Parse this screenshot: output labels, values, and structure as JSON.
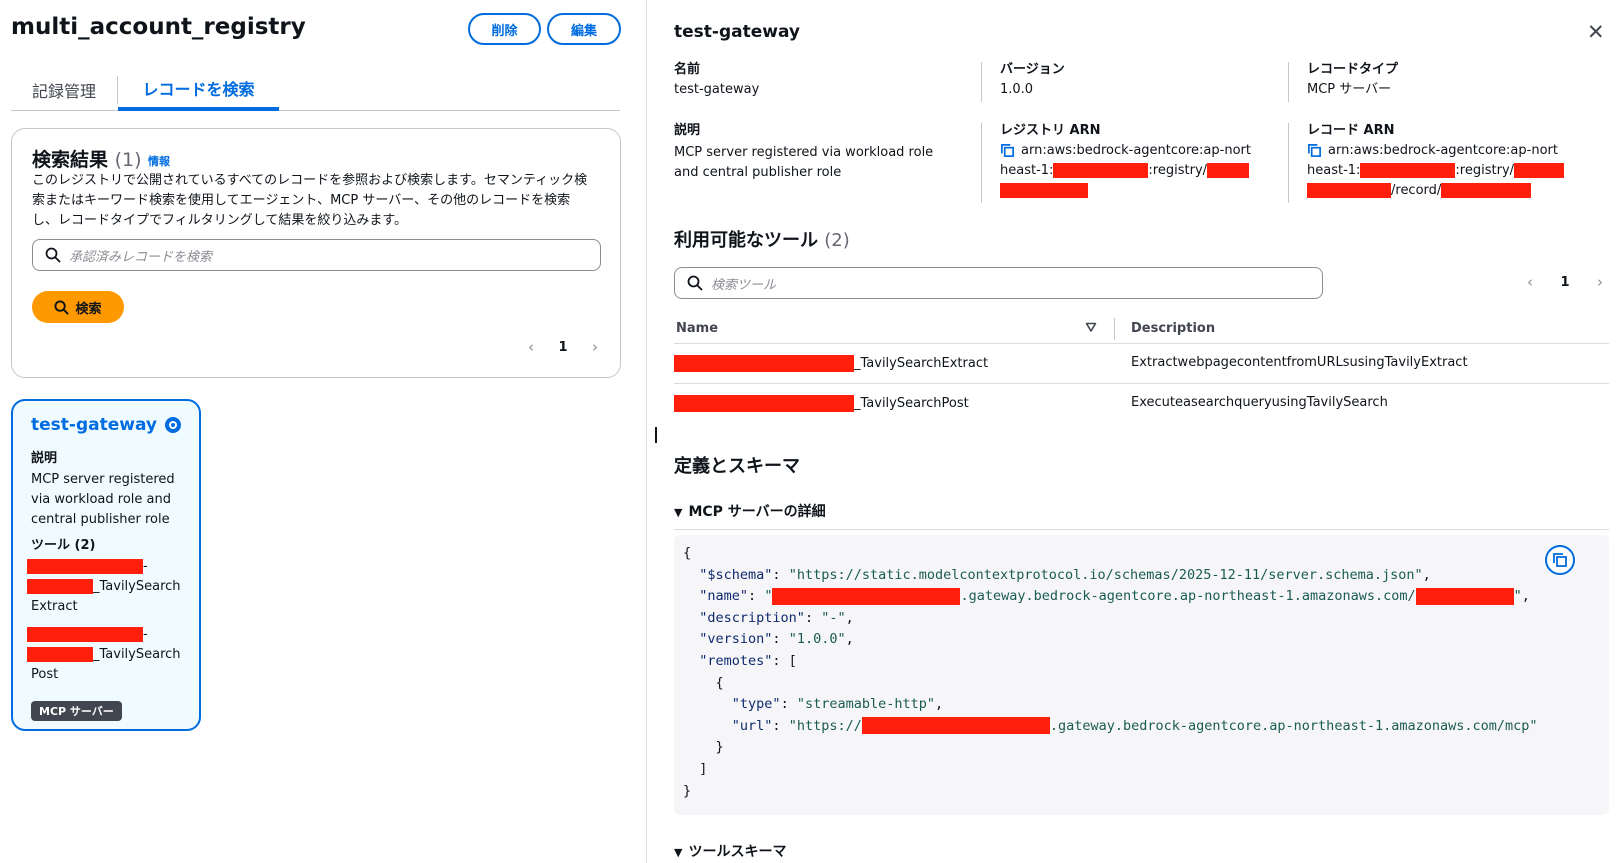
{
  "left": {
    "title": "multi_account_registry",
    "delete_label": "削除",
    "edit_label": "編集",
    "tabs": [
      {
        "label": "記録管理"
      },
      {
        "label": "レコードを検索"
      }
    ],
    "search_card": {
      "heading": "検索結果",
      "count": "(1)",
      "info": "情報",
      "description": "このレジストリで公開されているすべてのレコードを参照および検索します。セマンティック検索またはキーワード検索を使用してエージェント、MCP サーバー、その他のレコードを検索し、レコードタイプでフィルタリングして結果を絞り込みます。",
      "search_placeholder": "承認済みレコードを検索",
      "search_button": "検索",
      "page": "1"
    },
    "gateway_card": {
      "title": "test-gateway",
      "desc_label": "説明",
      "description": "MCP server registered via workload role and central publisher role",
      "tools_label": "ツール (2)",
      "tools": [
        {
          "suffix": "_TavilySearch",
          "tail": "Extract"
        },
        {
          "suffix": "_TavilySearch",
          "tail": "Post"
        }
      ],
      "badge": "MCP サーバー"
    }
  },
  "right": {
    "title": "test-gateway",
    "fields": {
      "name_label": "名前",
      "name_value": "test-gateway",
      "version_label": "バージョン",
      "version_value": "1.0.0",
      "record_type_label": "レコードタイプ",
      "record_type_value": "MCP サーバー",
      "description_label": "説明",
      "description_value": "MCP server registered via workload role and central publisher role",
      "registry_arn_label": "レジストリ ARN",
      "registry_arn_line1": "arn:aws:bedrock-agentcore:ap-nort",
      "registry_arn_prefix": "heast-1:",
      "registry_arn_mid": ":registry/",
      "record_arn_label": "レコード ARN",
      "record_arn_line1": "arn:aws:bedrock-agentcore:ap-nort",
      "record_arn_prefix": "heast-1:",
      "record_arn_mid": ":registry/",
      "record_arn_mid2": "/record/"
    },
    "tools_heading": "利用可能なツール",
    "tools_count": "(2)",
    "tools_search_placeholder": "検索ツール",
    "tools_page": "1",
    "table": {
      "headers": {
        "name": "Name",
        "description": "Description"
      },
      "rows": [
        {
          "name_suffix": "_TavilySearchExtract",
          "description": "ExtractwebpagecontentfromURLsusingTavilyExtract"
        },
        {
          "name_suffix": "_TavilySearchPost",
          "description": "ExecuteasearchqueryusingTavilySearch"
        }
      ]
    },
    "defs_heading": "定義とスキーマ",
    "mcp_details_label": "MCP サーバーの詳細",
    "tools_schema_label": "ツールスキーマ",
    "code": {
      "open_brace": "{",
      "schema_key": "\"$schema\"",
      "schema_val": "\"https://static.modelcontextprotocol.io/schemas/2025-12-11/server.schema.json\"",
      "name_key": "\"name\"",
      "name_val_open": "\"",
      "name_val_mid": ".gateway.bedrock-agentcore.ap-northeast-1.amazonaws.com/",
      "name_val_close": "\"",
      "desc_key": "\"description\"",
      "desc_val": "\"-\"",
      "version_key": "\"version\"",
      "version_val": "\"1.0.0\"",
      "remotes_key": "\"remotes\"",
      "type_key": "\"type\"",
      "type_val": "\"streamable-http\"",
      "url_key": "\"url\"",
      "url_val_open": "\"https://",
      "url_val_mid": ".gateway.bedrock-agentcore.ap-northeast-1.amazonaws.com/mcp\""
    }
  },
  "colors": {
    "accent": "#006ce0",
    "primary_button": "#ff9900",
    "redaction": "#ff1f0a",
    "badge": "#424650"
  }
}
